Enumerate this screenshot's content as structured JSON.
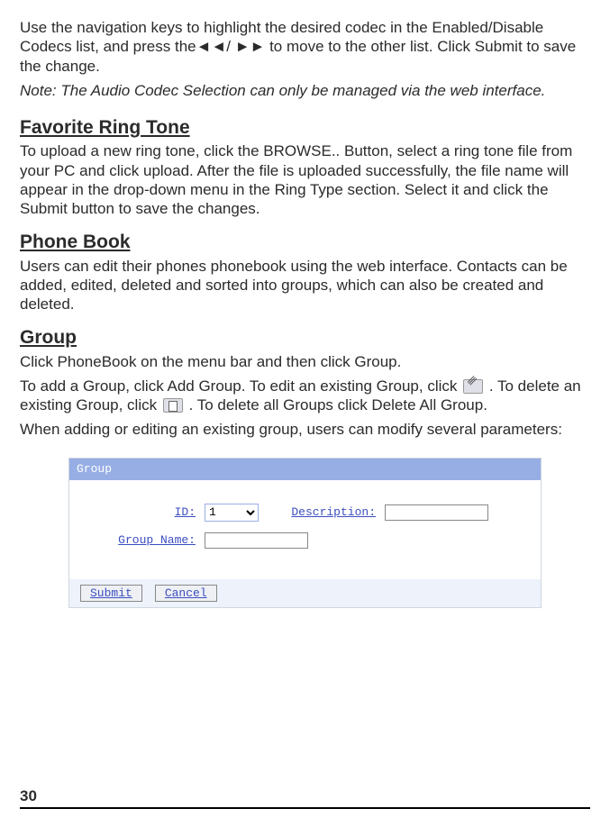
{
  "intro_para": "Use the navigation keys to highlight the desired codec in the Enabled/Disable Codecs list, and press the◄◄/ ►► to move to the other list.  Click Submit to save the change.",
  "intro_note": "Note: The Audio Codec Selection can only be managed via the web interface.",
  "sections": {
    "favorite": {
      "heading": "Favorite Ring Tone",
      "body": "To upload a new ring tone, click the BROWSE.. Button, select a ring tone file from your PC and click upload.  After the file is uploaded successfully, the file name will appear in the drop-down menu in the Ring Type section.  Select it and click the Submit button to save the changes."
    },
    "phonebook": {
      "heading": "Phone Book",
      "body": "Users can edit their phones phonebook using the web interface.  Contacts can be added, edited, deleted and sorted into groups, which can also be created and deleted."
    },
    "group": {
      "heading": "Group",
      "line1": "Click PhoneBook on the menu bar and then click Group.",
      "line2a": "To add a Group, click Add Group.  To edit an existing Group, click ",
      "line2b": ".  To delete an existing Group, click ",
      "line2c": " .  To delete all Groups click Delete All Group.",
      "line3": "When adding or editing an existing group, users can modify several parameters:"
    }
  },
  "form": {
    "boxTitle": "Group",
    "idLabel": "ID:",
    "idValue": "1",
    "descLabel": "Description:",
    "descValue": "",
    "nameLabel": "Group Name:",
    "nameValue": "",
    "submitLabel": "Submit",
    "cancelLabel": "Cancel"
  },
  "pageNumber": "30"
}
